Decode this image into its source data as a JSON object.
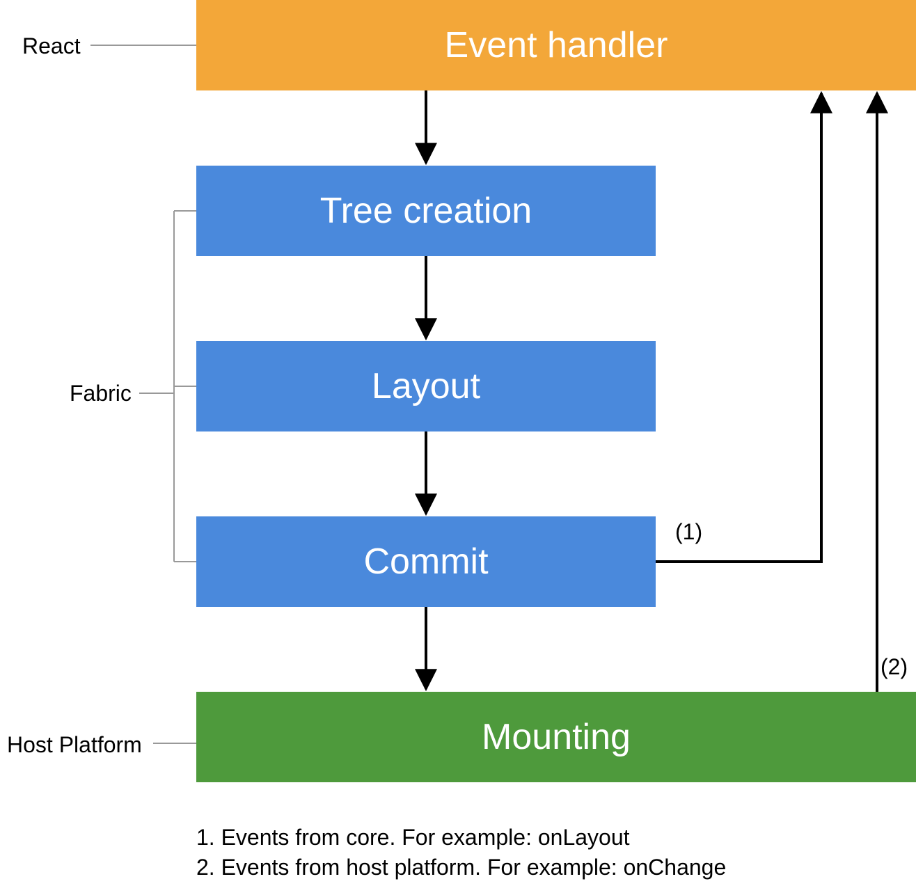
{
  "labels": {
    "react": "React",
    "fabric": "Fabric",
    "host_platform": "Host Platform"
  },
  "boxes": {
    "event_handler": "Event handler",
    "tree_creation": "Tree creation",
    "layout": "Layout",
    "commit": "Commit",
    "mounting": "Mounting"
  },
  "edge_labels": {
    "one": "(1)",
    "two": "(2)"
  },
  "footnotes": {
    "one": "1. Events from core. For example: onLayout",
    "two": "2. Events from host platform. For example: onChange"
  },
  "colors": {
    "orange": "#f3a739",
    "blue": "#4a89dc",
    "green": "#4e9a3c"
  }
}
